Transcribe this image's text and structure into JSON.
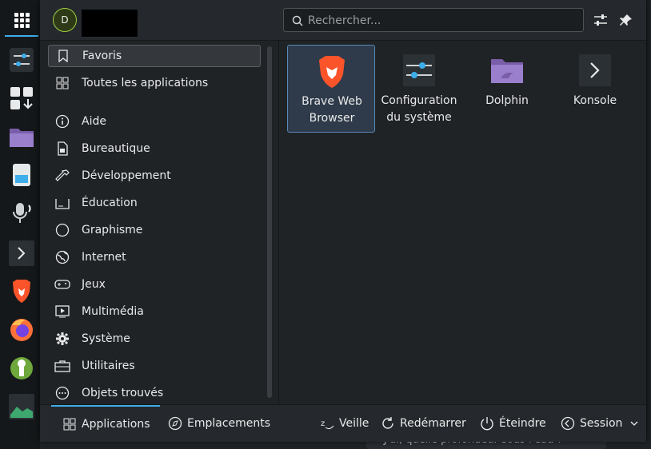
{
  "user": {
    "initial": "D"
  },
  "search": {
    "placeholder": "Rechercher..."
  },
  "categories": [
    {
      "label": "Favoris",
      "icon": "bookmark-icon"
    },
    {
      "label": "Toutes les applications",
      "icon": "grid-icon"
    },
    {
      "label": "Aide",
      "icon": "info-icon"
    },
    {
      "label": "Bureautique",
      "icon": "office-icon"
    },
    {
      "label": "Développement",
      "icon": "hammer-icon"
    },
    {
      "label": "Éducation",
      "icon": "education-icon"
    },
    {
      "label": "Graphisme",
      "icon": "graphics-icon"
    },
    {
      "label": "Internet",
      "icon": "globe-icon"
    },
    {
      "label": "Jeux",
      "icon": "gamepad-icon"
    },
    {
      "label": "Multimédia",
      "icon": "multimedia-icon"
    },
    {
      "label": "Système",
      "icon": "gear-icon"
    },
    {
      "label": "Utilitaires",
      "icon": "toolbox-icon"
    },
    {
      "label": "Objets trouvés",
      "icon": "ellipsis-icon"
    }
  ],
  "apps": [
    {
      "line1": "Brave Web",
      "line2": "Browser",
      "icon": "brave-icon"
    },
    {
      "line1": "Configuration",
      "line2": "du système",
      "icon": "settings-sliders-icon"
    },
    {
      "line1": "Dolphin",
      "line2": "",
      "icon": "folder-icon"
    },
    {
      "line1": "Konsole",
      "line2": "",
      "icon": "terminal-icon"
    }
  ],
  "footer": {
    "applications": "Applications",
    "places": "Emplacements",
    "sleep": "Veille",
    "restart": "Redémarrer",
    "shutdown": "Éteindre",
    "session": "Session"
  },
  "background": {
    "bottom_text": "J'ai, quelle profondeur sous l'eau ?"
  },
  "colors": {
    "accent": "#3daee9",
    "selection": "#5689b6"
  }
}
